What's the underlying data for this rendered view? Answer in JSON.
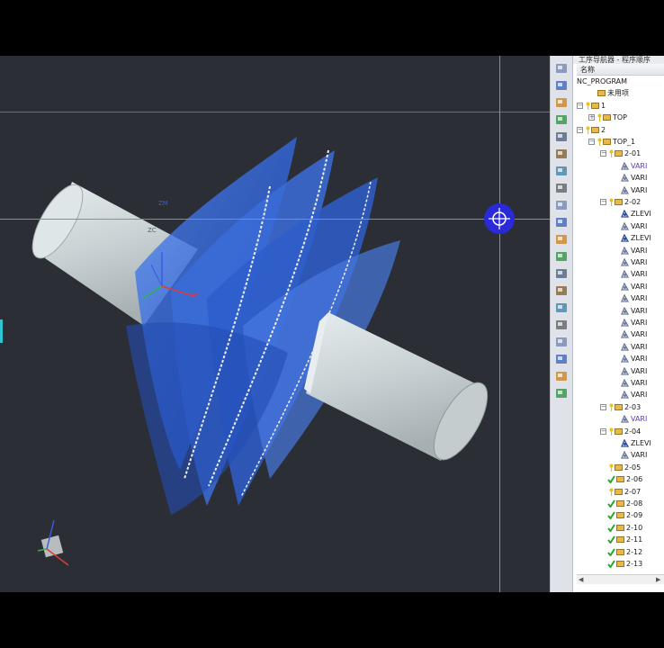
{
  "viewport": {
    "axis_labels": {
      "zm": "ZM",
      "zc": "ZC",
      "xm": "XM",
      "xc": "XC"
    },
    "icons": [
      "rotate-center-icon",
      "wcs-triad-icon"
    ]
  },
  "navigator": {
    "title": "工序导航器 - 程序顺序",
    "column_header": "名称",
    "tree": [
      {
        "label": "NC_PROGRAM",
        "depth": 0,
        "type": "root"
      },
      {
        "label": "未用项",
        "depth": 1,
        "type": "folder"
      },
      {
        "label": "1",
        "depth": 0,
        "type": "group",
        "expander": "−",
        "key": true
      },
      {
        "label": "TOP",
        "depth": 1,
        "type": "group",
        "expander": "+",
        "key": true
      },
      {
        "label": "2",
        "depth": 0,
        "type": "group",
        "expander": "−",
        "key": true
      },
      {
        "label": "TOP_1",
        "depth": 1,
        "type": "group",
        "expander": "−",
        "key": true
      },
      {
        "label": "2-01",
        "depth": 2,
        "type": "group",
        "expander": "−",
        "key": true
      },
      {
        "label": "VARI",
        "depth": 3,
        "type": "op",
        "purple": true
      },
      {
        "label": "VARI",
        "depth": 3,
        "type": "op"
      },
      {
        "label": "VARI",
        "depth": 3,
        "type": "op"
      },
      {
        "label": "2-02",
        "depth": 2,
        "type": "group",
        "expander": "−",
        "key": true
      },
      {
        "label": "ZLEVI",
        "depth": 3,
        "type": "zlevel"
      },
      {
        "label": "VARI",
        "depth": 3,
        "type": "op"
      },
      {
        "label": "ZLEVI",
        "depth": 3,
        "type": "zlevel"
      },
      {
        "label": "VARI",
        "depth": 3,
        "type": "op"
      },
      {
        "label": "VARI",
        "depth": 3,
        "type": "op"
      },
      {
        "label": "VARI",
        "depth": 3,
        "type": "op"
      },
      {
        "label": "VARI",
        "depth": 3,
        "type": "op"
      },
      {
        "label": "VARI",
        "depth": 3,
        "type": "op"
      },
      {
        "label": "VARI",
        "depth": 3,
        "type": "op"
      },
      {
        "label": "VARI",
        "depth": 3,
        "type": "op"
      },
      {
        "label": "VARI",
        "depth": 3,
        "type": "op"
      },
      {
        "label": "VARI",
        "depth": 3,
        "type": "op"
      },
      {
        "label": "VARI",
        "depth": 3,
        "type": "op"
      },
      {
        "label": "VARI",
        "depth": 3,
        "type": "op"
      },
      {
        "label": "VARI",
        "depth": 3,
        "type": "op"
      },
      {
        "label": "VARI",
        "depth": 3,
        "type": "op"
      },
      {
        "label": "2-03",
        "depth": 2,
        "type": "group",
        "expander": "−",
        "key": true
      },
      {
        "label": "VARI",
        "depth": 3,
        "type": "op",
        "purple": true
      },
      {
        "label": "2-04",
        "depth": 2,
        "type": "group",
        "expander": "−",
        "key": true
      },
      {
        "label": "ZLEVI",
        "depth": 3,
        "type": "zlevel"
      },
      {
        "label": "VARI",
        "depth": 3,
        "type": "op"
      },
      {
        "label": "2-05",
        "depth": 2,
        "type": "group",
        "key": true
      },
      {
        "label": "2-06",
        "depth": 2,
        "type": "group",
        "check": true
      },
      {
        "label": "2-07",
        "depth": 2,
        "type": "group",
        "key": true
      },
      {
        "label": "2-08",
        "depth": 2,
        "type": "group",
        "check": true
      },
      {
        "label": "2-09",
        "depth": 2,
        "type": "group",
        "check": true
      },
      {
        "label": "2-10",
        "depth": 2,
        "type": "group",
        "check": true
      },
      {
        "label": "2-11",
        "depth": 2,
        "type": "group",
        "check": true
      },
      {
        "label": "2-12",
        "depth": 2,
        "type": "group",
        "check": true
      },
      {
        "label": "2-13",
        "depth": 2,
        "type": "group",
        "check": true
      }
    ]
  },
  "toolbar": {
    "icons": [
      "machine-tool-view-icon",
      "program-order-view-icon",
      "geometry-view-icon",
      "method-view-icon",
      "create-program-icon",
      "create-tool-icon",
      "create-geometry-icon",
      "create-method-icon",
      "create-operation-icon",
      "generate-toolpath-icon",
      "replay-toolpath-icon",
      "verify-toolpath-icon",
      "postprocess-icon",
      "shop-doc-icon",
      "simulate-icon",
      "list-toolpath-icon",
      "check-icon",
      "output-cls-icon",
      "feeds-speeds-icon",
      "tool-icon"
    ]
  },
  "colors": {
    "viewport_bg": "#2b2e34",
    "part_blue": "#3a6fe0",
    "shaft_gray": "#cfd6d8",
    "check_green": "#2aa52a",
    "key_yellow": "#e8c21a"
  }
}
